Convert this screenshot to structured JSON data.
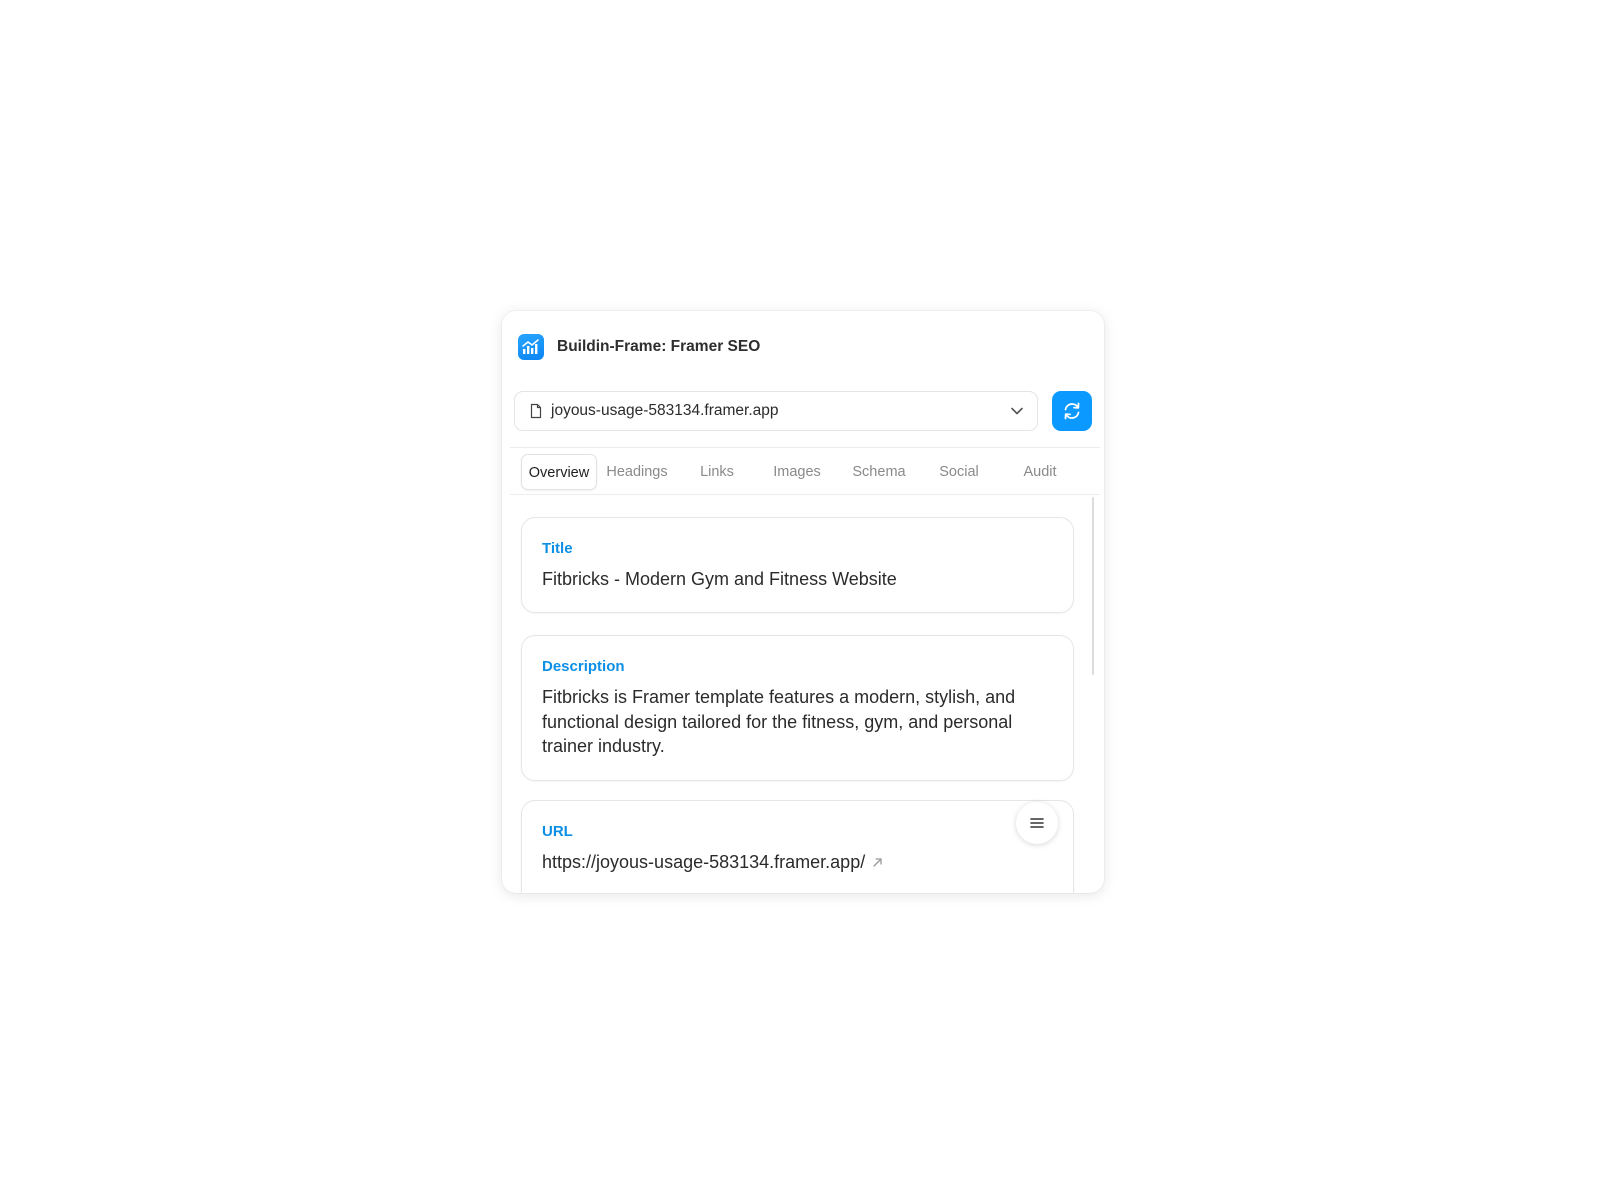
{
  "app": {
    "title": "Buildin-Frame: Framer SEO",
    "icon": "chart-icon",
    "accent": "#0b99ff"
  },
  "page_select": {
    "value": "joyous-usage-583134.framer.app",
    "icon": "file-icon"
  },
  "refresh": {
    "icon": "refresh-icon"
  },
  "tabs": [
    {
      "label": "Overview",
      "active": true
    },
    {
      "label": "Headings",
      "active": false
    },
    {
      "label": "Links",
      "active": false
    },
    {
      "label": "Images",
      "active": false
    },
    {
      "label": "Schema",
      "active": false
    },
    {
      "label": "Social",
      "active": false
    },
    {
      "label": "Audit",
      "active": false
    }
  ],
  "overview": {
    "title": {
      "label": "Title",
      "value": "Fitbricks - Modern Gym and Fitness Website"
    },
    "description": {
      "label": "Description",
      "value": "Fitbricks is Framer template features a modern, stylish, and functional design tailored for the fitness, gym, and personal trainer industry."
    },
    "url": {
      "label": "URL",
      "value": "https://joyous-usage-583134.framer.app/"
    }
  },
  "fab": {
    "icon": "menu-icon"
  },
  "colors": {
    "label_blue": "#0d8fe6",
    "button_blue": "#0b99ff"
  }
}
